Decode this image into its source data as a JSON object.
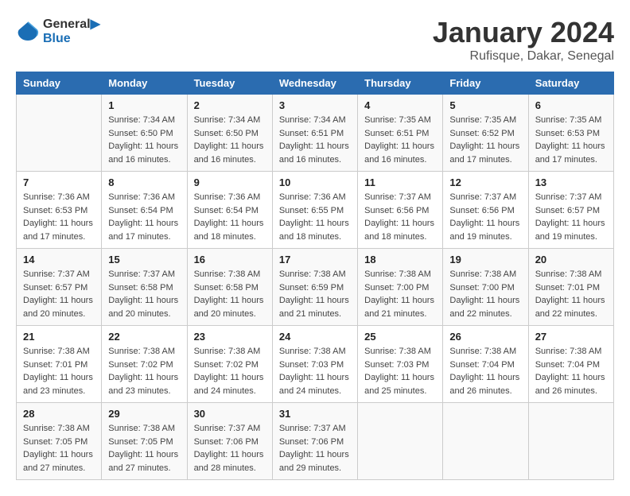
{
  "header": {
    "logo_line1": "General",
    "logo_line2": "Blue",
    "month_title": "January 2024",
    "subtitle": "Rufisque, Dakar, Senegal"
  },
  "weekdays": [
    "Sunday",
    "Monday",
    "Tuesday",
    "Wednesday",
    "Thursday",
    "Friday",
    "Saturday"
  ],
  "weeks": [
    [
      {
        "day": "",
        "sunrise": "",
        "sunset": "",
        "daylight": ""
      },
      {
        "day": "1",
        "sunrise": "Sunrise: 7:34 AM",
        "sunset": "Sunset: 6:50 PM",
        "daylight": "Daylight: 11 hours and 16 minutes."
      },
      {
        "day": "2",
        "sunrise": "Sunrise: 7:34 AM",
        "sunset": "Sunset: 6:50 PM",
        "daylight": "Daylight: 11 hours and 16 minutes."
      },
      {
        "day": "3",
        "sunrise": "Sunrise: 7:34 AM",
        "sunset": "Sunset: 6:51 PM",
        "daylight": "Daylight: 11 hours and 16 minutes."
      },
      {
        "day": "4",
        "sunrise": "Sunrise: 7:35 AM",
        "sunset": "Sunset: 6:51 PM",
        "daylight": "Daylight: 11 hours and 16 minutes."
      },
      {
        "day": "5",
        "sunrise": "Sunrise: 7:35 AM",
        "sunset": "Sunset: 6:52 PM",
        "daylight": "Daylight: 11 hours and 17 minutes."
      },
      {
        "day": "6",
        "sunrise": "Sunrise: 7:35 AM",
        "sunset": "Sunset: 6:53 PM",
        "daylight": "Daylight: 11 hours and 17 minutes."
      }
    ],
    [
      {
        "day": "7",
        "sunrise": "Sunrise: 7:36 AM",
        "sunset": "Sunset: 6:53 PM",
        "daylight": "Daylight: 11 hours and 17 minutes."
      },
      {
        "day": "8",
        "sunrise": "Sunrise: 7:36 AM",
        "sunset": "Sunset: 6:54 PM",
        "daylight": "Daylight: 11 hours and 17 minutes."
      },
      {
        "day": "9",
        "sunrise": "Sunrise: 7:36 AM",
        "sunset": "Sunset: 6:54 PM",
        "daylight": "Daylight: 11 hours and 18 minutes."
      },
      {
        "day": "10",
        "sunrise": "Sunrise: 7:36 AM",
        "sunset": "Sunset: 6:55 PM",
        "daylight": "Daylight: 11 hours and 18 minutes."
      },
      {
        "day": "11",
        "sunrise": "Sunrise: 7:37 AM",
        "sunset": "Sunset: 6:56 PM",
        "daylight": "Daylight: 11 hours and 18 minutes."
      },
      {
        "day": "12",
        "sunrise": "Sunrise: 7:37 AM",
        "sunset": "Sunset: 6:56 PM",
        "daylight": "Daylight: 11 hours and 19 minutes."
      },
      {
        "day": "13",
        "sunrise": "Sunrise: 7:37 AM",
        "sunset": "Sunset: 6:57 PM",
        "daylight": "Daylight: 11 hours and 19 minutes."
      }
    ],
    [
      {
        "day": "14",
        "sunrise": "Sunrise: 7:37 AM",
        "sunset": "Sunset: 6:57 PM",
        "daylight": "Daylight: 11 hours and 20 minutes."
      },
      {
        "day": "15",
        "sunrise": "Sunrise: 7:37 AM",
        "sunset": "Sunset: 6:58 PM",
        "daylight": "Daylight: 11 hours and 20 minutes."
      },
      {
        "day": "16",
        "sunrise": "Sunrise: 7:38 AM",
        "sunset": "Sunset: 6:58 PM",
        "daylight": "Daylight: 11 hours and 20 minutes."
      },
      {
        "day": "17",
        "sunrise": "Sunrise: 7:38 AM",
        "sunset": "Sunset: 6:59 PM",
        "daylight": "Daylight: 11 hours and 21 minutes."
      },
      {
        "day": "18",
        "sunrise": "Sunrise: 7:38 AM",
        "sunset": "Sunset: 7:00 PM",
        "daylight": "Daylight: 11 hours and 21 minutes."
      },
      {
        "day": "19",
        "sunrise": "Sunrise: 7:38 AM",
        "sunset": "Sunset: 7:00 PM",
        "daylight": "Daylight: 11 hours and 22 minutes."
      },
      {
        "day": "20",
        "sunrise": "Sunrise: 7:38 AM",
        "sunset": "Sunset: 7:01 PM",
        "daylight": "Daylight: 11 hours and 22 minutes."
      }
    ],
    [
      {
        "day": "21",
        "sunrise": "Sunrise: 7:38 AM",
        "sunset": "Sunset: 7:01 PM",
        "daylight": "Daylight: 11 hours and 23 minutes."
      },
      {
        "day": "22",
        "sunrise": "Sunrise: 7:38 AM",
        "sunset": "Sunset: 7:02 PM",
        "daylight": "Daylight: 11 hours and 23 minutes."
      },
      {
        "day": "23",
        "sunrise": "Sunrise: 7:38 AM",
        "sunset": "Sunset: 7:02 PM",
        "daylight": "Daylight: 11 hours and 24 minutes."
      },
      {
        "day": "24",
        "sunrise": "Sunrise: 7:38 AM",
        "sunset": "Sunset: 7:03 PM",
        "daylight": "Daylight: 11 hours and 24 minutes."
      },
      {
        "day": "25",
        "sunrise": "Sunrise: 7:38 AM",
        "sunset": "Sunset: 7:03 PM",
        "daylight": "Daylight: 11 hours and 25 minutes."
      },
      {
        "day": "26",
        "sunrise": "Sunrise: 7:38 AM",
        "sunset": "Sunset: 7:04 PM",
        "daylight": "Daylight: 11 hours and 26 minutes."
      },
      {
        "day": "27",
        "sunrise": "Sunrise: 7:38 AM",
        "sunset": "Sunset: 7:04 PM",
        "daylight": "Daylight: 11 hours and 26 minutes."
      }
    ],
    [
      {
        "day": "28",
        "sunrise": "Sunrise: 7:38 AM",
        "sunset": "Sunset: 7:05 PM",
        "daylight": "Daylight: 11 hours and 27 minutes."
      },
      {
        "day": "29",
        "sunrise": "Sunrise: 7:38 AM",
        "sunset": "Sunset: 7:05 PM",
        "daylight": "Daylight: 11 hours and 27 minutes."
      },
      {
        "day": "30",
        "sunrise": "Sunrise: 7:37 AM",
        "sunset": "Sunset: 7:06 PM",
        "daylight": "Daylight: 11 hours and 28 minutes."
      },
      {
        "day": "31",
        "sunrise": "Sunrise: 7:37 AM",
        "sunset": "Sunset: 7:06 PM",
        "daylight": "Daylight: 11 hours and 29 minutes."
      },
      {
        "day": "",
        "sunrise": "",
        "sunset": "",
        "daylight": ""
      },
      {
        "day": "",
        "sunrise": "",
        "sunset": "",
        "daylight": ""
      },
      {
        "day": "",
        "sunrise": "",
        "sunset": "",
        "daylight": ""
      }
    ]
  ]
}
